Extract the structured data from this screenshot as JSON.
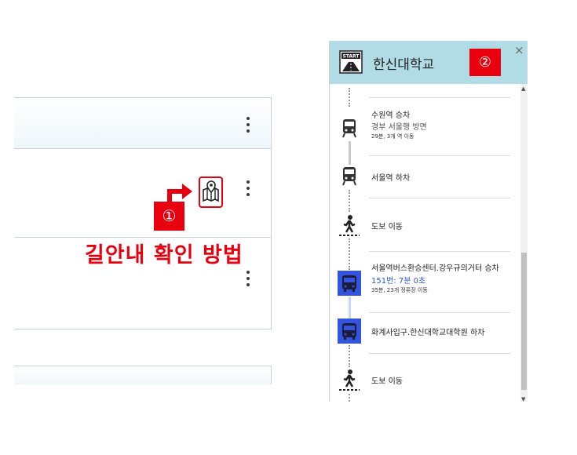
{
  "annotation": {
    "marker_1": "①",
    "marker_2": "②",
    "howto_text": "길안내 확인 방법",
    "accent_color": "#e8000f"
  },
  "left_list": {
    "icons": [
      "kebab-menu-icon",
      "map-route-icon"
    ]
  },
  "route_panel": {
    "destination": "한신대학교",
    "close_label": "×",
    "start_icon_label": "START",
    "steps": [
      {
        "type": "bus-train",
        "title": "수원역 승차",
        "sub": "경부 서울행 방면",
        "info": "29분, 3개 역 이동"
      },
      {
        "type": "bus-train",
        "title": "서울역 하차"
      },
      {
        "type": "walk",
        "title": "도보 이동"
      },
      {
        "type": "bus",
        "title": "서울역버스환승센터.강우규의거터 승차",
        "sub": "151번: 7분 0초",
        "info": "35분, 23개 정류장 이동"
      },
      {
        "type": "bus",
        "title": "화계사입구.한신대학교대학원 하차"
      },
      {
        "type": "walk",
        "title": "도보 이동"
      }
    ]
  }
}
